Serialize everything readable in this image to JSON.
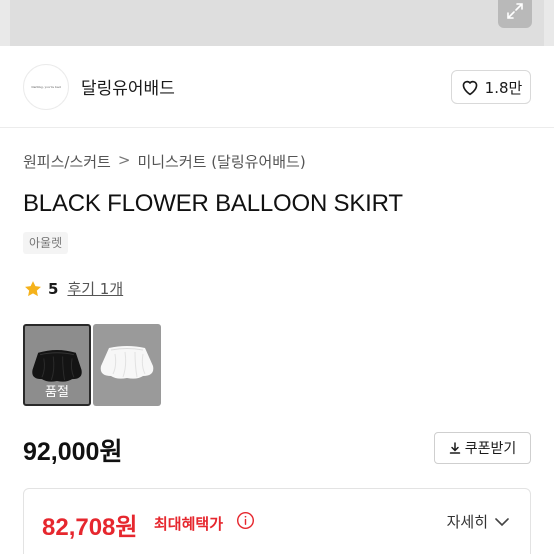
{
  "top": {
    "expand_icon": "expand-arrows-icon"
  },
  "shop": {
    "logo_text": "Darling, you're bad",
    "name": "달링유어배드",
    "like_count": "1.8만",
    "like_icon": "heart-outline-icon"
  },
  "breadcrumb": {
    "items": [
      "원피스/스커트",
      "미니스커트 (달링유어배드)"
    ],
    "separator": ">"
  },
  "product": {
    "title": "BLACK FLOWER BALLOON SKIRT",
    "tag": "아울렛",
    "rating": "5",
    "reviews": "후기 1개",
    "star_color": "#f5b21b",
    "options": [
      {
        "color": "black",
        "status": "품절",
        "selected": true
      },
      {
        "color": "white",
        "status": "",
        "selected": false
      }
    ],
    "price": "92,000원",
    "coupon_label": "쿠폰받기",
    "coupon_icon": "download-icon"
  },
  "benefit": {
    "price": "82,708원",
    "label": "최대혜택가",
    "info_icon": "info-circle-icon",
    "detail_label": "자세히",
    "accent_color": "#e6272e"
  }
}
